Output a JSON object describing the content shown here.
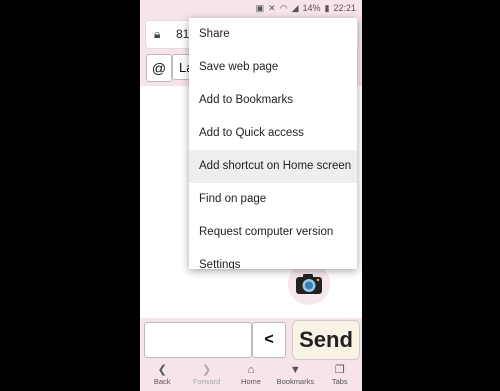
{
  "status": {
    "battery": "14%",
    "time": "22:21"
  },
  "urlbar": {
    "url": "81.a"
  },
  "toolbar": {
    "at_label": "@",
    "language_text": "La"
  },
  "menu": {
    "items": [
      "Share",
      "Save web page",
      "Add to Bookmarks",
      "Add to Quick access",
      "Add shortcut on Home screen",
      "Find on page",
      "Request computer version",
      "Settings"
    ]
  },
  "input": {
    "less_label": "<",
    "send_label": "Send"
  },
  "nav": {
    "items": [
      "Back",
      "Forward",
      "Home",
      "Bookmarks",
      "Tabs"
    ]
  }
}
